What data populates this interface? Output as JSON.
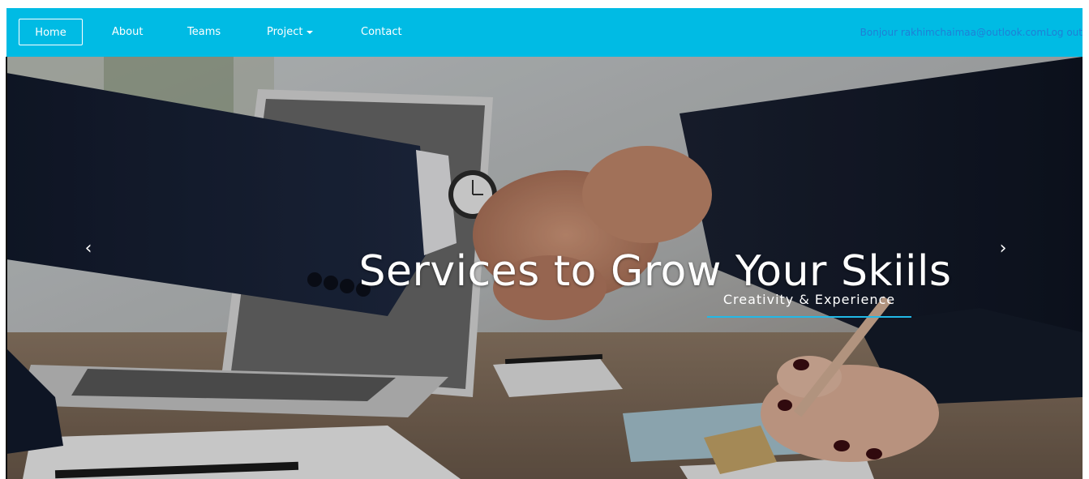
{
  "nav": {
    "items": [
      {
        "label": "Home"
      },
      {
        "label": "About"
      },
      {
        "label": "Teams"
      },
      {
        "label": "Project"
      },
      {
        "label": "Contact"
      }
    ],
    "greeting": "Bonjour rakhimchaimaa@outlook.com",
    "logout": "Log out"
  },
  "hero": {
    "title": "Services to Grow Your Skiils",
    "subtitle": "Creativity & Experience"
  },
  "colors": {
    "navbar": "#00bbe4",
    "accent": "#22b8e6",
    "user_link": "#1f7fd6"
  },
  "icons": {
    "prev": "chevron-left-icon",
    "next": "chevron-right-icon",
    "dropdown": "caret-down-icon"
  }
}
